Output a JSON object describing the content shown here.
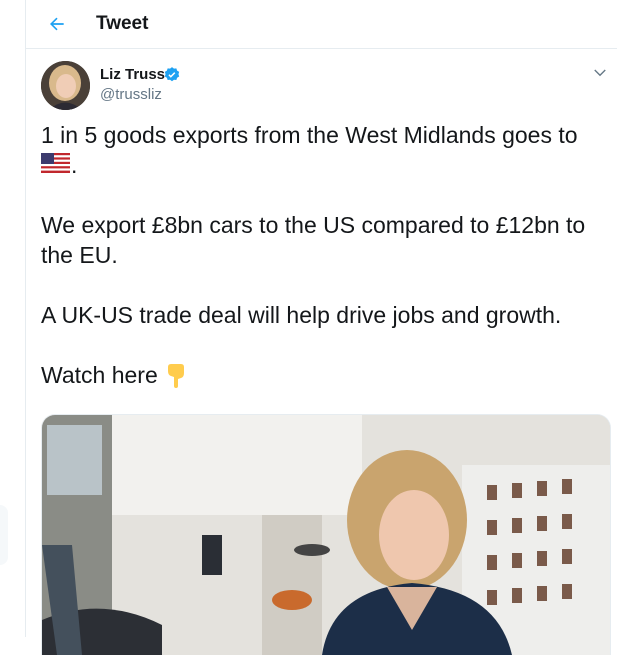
{
  "header": {
    "title": "Tweet",
    "back_icon": "back-arrow-icon"
  },
  "author": {
    "name": "Liz Truss",
    "handle": "@trussliz",
    "verified_icon": "verified-badge-icon"
  },
  "tweet": {
    "lines": [
      "1 in 5 goods exports from the West Midlands goes to",
      ".",
      "We export £8bn cars to the US compared to £12bn to",
      "the EU.",
      "A UK-US trade deal will help drive jobs and growth.",
      "Watch here"
    ],
    "emoji": {
      "flag": "us-flag-icon",
      "point": "point-down-icon"
    }
  },
  "media": {
    "type": "video"
  },
  "colors": {
    "accent": "#1da1f2",
    "text": "#14171a",
    "secondary": "#657786",
    "border": "#e6ecf0"
  }
}
